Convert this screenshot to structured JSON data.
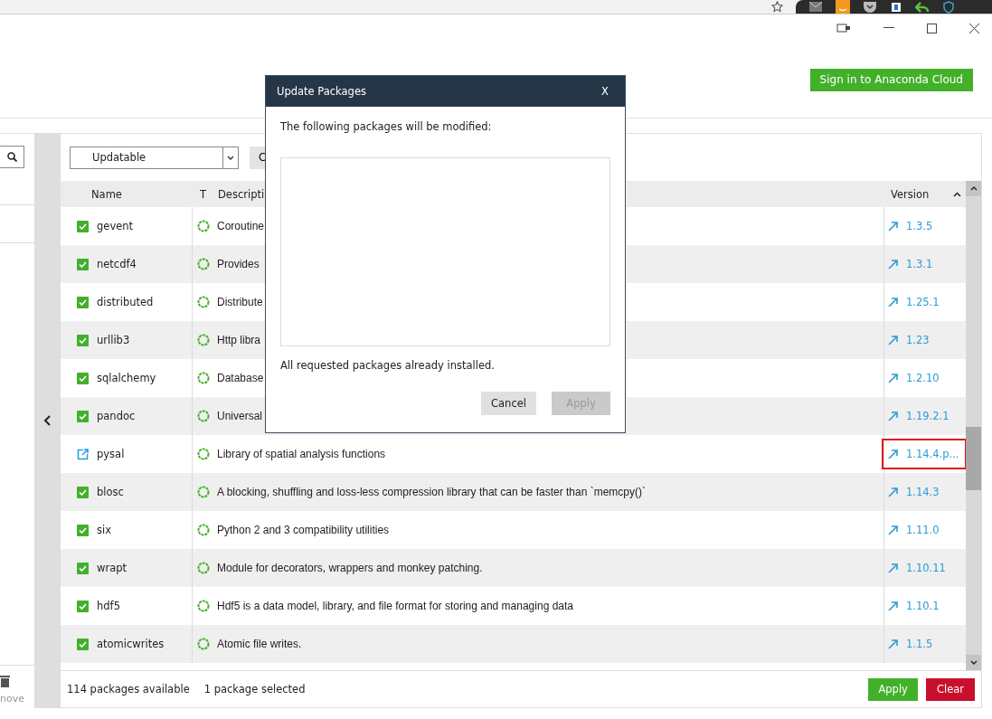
{
  "header": {
    "sign_in_button": "Sign in to Anaconda Cloud"
  },
  "sidebar": {
    "remove_label": "nove"
  },
  "filter": {
    "value": "Updatable"
  },
  "channels_button": "C",
  "table": {
    "columns": [
      "Name",
      "T",
      "Descripti",
      "Version"
    ],
    "rows": [
      {
        "name": "gevent",
        "description": "Coroutine",
        "version": "1.3.5",
        "selected": false
      },
      {
        "name": "netcdf4",
        "description": "Provides",
        "version": "1.3.1",
        "selected": false
      },
      {
        "name": "distributed",
        "description": "Distribute",
        "version": "1.25.1",
        "selected": false
      },
      {
        "name": "urllib3",
        "description": "Http libra",
        "version": "1.23",
        "selected": false
      },
      {
        "name": "sqlalchemy",
        "description": "Database",
        "version": "1.2.10",
        "selected": false
      },
      {
        "name": "pandoc",
        "description": "Universal",
        "version": "1.19.2.1",
        "selected": false
      },
      {
        "name": "pysal",
        "description": "Library of spatial analysis functions",
        "version": "1.14.4.p...",
        "selected": true
      },
      {
        "name": "blosc",
        "description": "A blocking, shuffling and loss-less compression library that can be faster than `memcpy()`",
        "version": "1.14.3",
        "selected": false
      },
      {
        "name": "six",
        "description": "Python 2 and 3 compatibility utilities",
        "version": "1.11.0",
        "selected": false
      },
      {
        "name": "wrapt",
        "description": "Module for decorators, wrappers and monkey patching.",
        "version": "1.10.11",
        "selected": false
      },
      {
        "name": "hdf5",
        "description": "Hdf5 is a data model, library, and file format for storing and managing data",
        "version": "1.10.1",
        "selected": false
      },
      {
        "name": "atomicwrites",
        "description": "Atomic file writes.",
        "version": "1.1.5",
        "selected": false
      }
    ]
  },
  "footer": {
    "available": "114 packages available",
    "selected_count": "1 package selected",
    "buttons": [
      {
        "label": "Apply",
        "kind": "apply"
      },
      {
        "label": "Clear",
        "kind": "clear"
      }
    ]
  },
  "dialog": {
    "title": "Update Packages",
    "close": "X",
    "message": "The following packages will be modified:",
    "status": "All requested packages already installed.",
    "buttons": [
      {
        "label": "Cancel",
        "disabled": false
      },
      {
        "label": "Apply",
        "disabled": true
      }
    ]
  }
}
